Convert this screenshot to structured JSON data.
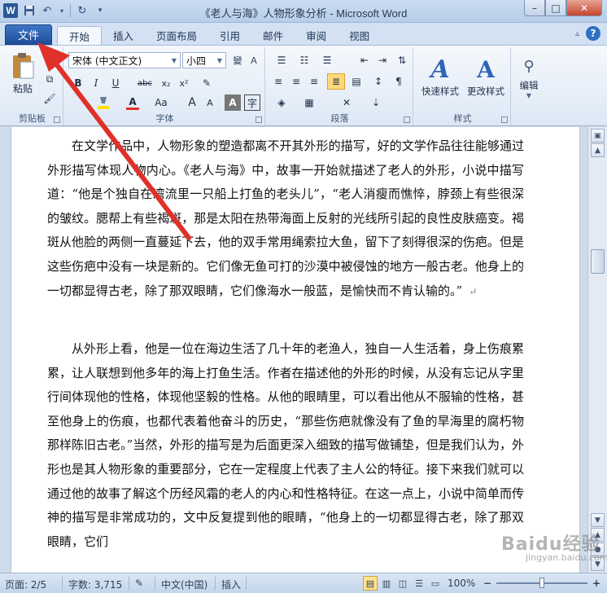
{
  "window": {
    "title": "《老人与海》人物形象分析 - Microsoft Word",
    "app_letter": "W",
    "controls": {
      "minimize": "–",
      "maximize": "□",
      "close": "✕"
    }
  },
  "tabs": {
    "file": "文件",
    "items": [
      "开始",
      "插入",
      "页面布局",
      "引用",
      "邮件",
      "审阅",
      "视图"
    ],
    "active": "开始",
    "help": "?"
  },
  "ribbon": {
    "clipboard": {
      "paste": "粘贴",
      "label": "剪贴板"
    },
    "font": {
      "name": "宋体 (中文正文)",
      "size": "小四",
      "label": "字体",
      "buttons": [
        "B",
        "I",
        "U",
        "abc",
        "x₂",
        "x²",
        "A",
        "Aa",
        "A",
        "A"
      ]
    },
    "paragraph": {
      "label": "段落"
    },
    "styles": {
      "quick": "快速样式",
      "change": "更改样式",
      "label": "样式"
    },
    "editing": {
      "label": "编辑"
    }
  },
  "document": {
    "paragraphs": [
      "在文学作品中，人物形象的塑造都离不开其外形的描写，好的文学作品往往能够通过外形描写体现人物内心。《老人与海》中，故事一开始就描述了老人的外形，小说中描写道：“他是个独自在湾流里一只船上打鱼的老头儿”，“老人消瘦而憔悴，脖颈上有些很深的皱纹。腮帮上有些褐斑，那是太阳在热带海面上反射的光线所引起的良性皮肤癌变。褐斑从他脸的两侧一直蔓延下去，他的双手常用绳索拉大鱼，留下了刻得很深的伤疤。但是这些伤疤中没有一块是新的。它们像无鱼可打的沙漠中被侵蚀的地方一般古老。他身上的一切都显得古老，除了那双眼睛，它们像海水一般蓝，是愉快而不肯认输的。”",
      "从外形上看，他是一位在海边生活了几十年的老渔人，独自一人生活着，身上伤痕累累，让人联想到他多年的海上打鱼生活。作者在描述他的外形的时候，从没有忘记从字里行间体现他的性格，体现他坚毅的性格。从他的眼睛里，可以看出他从不服输的性格，甚至他身上的伤痕，也都代表着他奋斗的历史，“那些伤疤就像没有了鱼的旱海里的腐朽物那样陈旧古老。”当然，外形的描写是为后面更深入细致的描写做铺垫，但是我们认为，外形也是其人物形象的重要部分，它在一定程度上代表了主人公的特征。接下来我们就可以通过他的故事了解这个历经风霜的老人的内心和性格特征。在这一点上，小说中简单而传神的描写是非常成功的，文中反复提到他的眼睛，“他身上的一切都显得古老，除了那双眼睛，它们"
    ],
    "paragraph_mark": "↵"
  },
  "status": {
    "page": "页面: 2/5",
    "words": "字数: 3,715",
    "language": "中文(中国)",
    "mode": "插入",
    "zoom": "100%",
    "zoom_minus": "−",
    "zoom_plus": "+",
    "zoom_level": 0.5
  },
  "watermark": {
    "text": "Baidu经验",
    "sub": "jingyan.baidu.com"
  },
  "colors": {
    "file_tab": "#2b5797",
    "annotation_arrow": "#e0302a",
    "highlight": "#ffd978"
  }
}
